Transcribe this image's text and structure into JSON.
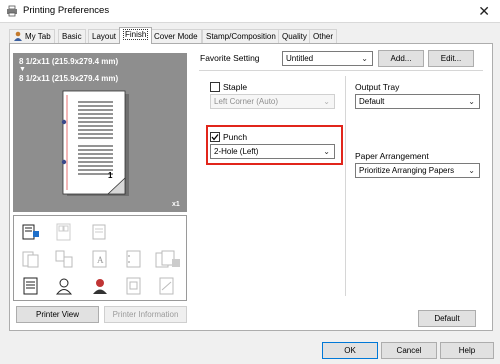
{
  "window": {
    "title": "Printing Preferences",
    "close_glyph": "✕"
  },
  "tabs": [
    {
      "label": "My Tab",
      "active": false
    },
    {
      "label": "Basic",
      "active": false
    },
    {
      "label": "Layout",
      "active": false
    },
    {
      "label": "Finish",
      "active": true
    },
    {
      "label": "Cover Mode",
      "active": false
    },
    {
      "label": "Stamp/Composition",
      "active": false
    },
    {
      "label": "Quality",
      "active": false
    },
    {
      "label": "Other",
      "active": false
    }
  ],
  "preview": {
    "paper_line1": "8 1/2x11 (215.9x279.4 mm)",
    "arrow": "▼",
    "paper_line2": "8 1/2x11 (215.9x279.4 mm)",
    "page_number": "1",
    "copies": "x1"
  },
  "left_buttons": {
    "printer_view": "Printer View",
    "printer_information": "Printer Information"
  },
  "favorite": {
    "label": "Favorite Setting",
    "value": "Untitled",
    "add": "Add...",
    "edit": "Edit..."
  },
  "staple": {
    "label": "Staple",
    "checked": false,
    "value": "Left Corner (Auto)"
  },
  "punch": {
    "label": "Punch",
    "checked": true,
    "value": "2-Hole (Left)"
  },
  "output_tray": {
    "label": "Output Tray",
    "value": "Default"
  },
  "paper_arrangement": {
    "label": "Paper Arrangement",
    "value": "Prioritize Arranging Papers"
  },
  "default_button": "Default",
  "footer": {
    "ok": "OK",
    "cancel": "Cancel",
    "help": "Help"
  },
  "colors": {
    "highlight": "#e1251b",
    "preview_bg": "#8e8e8e",
    "panel_bg": "#ffffff",
    "window_bg": "#f0f0f0"
  }
}
